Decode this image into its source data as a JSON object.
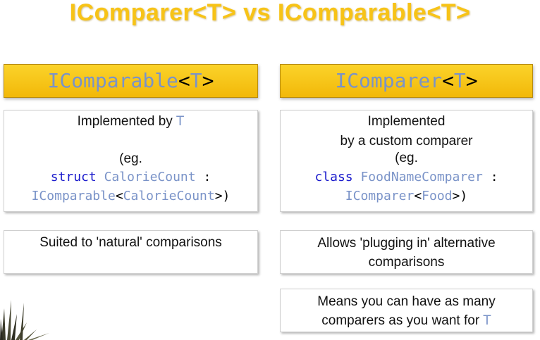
{
  "title": "IComparer<T> vs IComparable<T>",
  "left": {
    "header": {
      "name": "IComparable",
      "lt": "<",
      "t": "T",
      "gt": ">"
    },
    "box1": {
      "line1": "Implemented by ",
      "line1_t": "T",
      "eg": "(eg.",
      "kw": "struct",
      "type": "CalorieCount",
      "colon": ":",
      "iface": "IComparable",
      "lt": "<",
      "arg": "CalorieCount",
      "close": ">)"
    },
    "box2": {
      "text": "Suited to 'natural' comparisons"
    }
  },
  "right": {
    "header": {
      "name": "IComparer",
      "lt": "<",
      "t": "T",
      "gt": ">"
    },
    "box1": {
      "line1": "Implemented",
      "line2": "by a custom comparer",
      "eg": "(eg.",
      "kw": "class",
      "type": "FoodNameComparer",
      "colon": ":",
      "iface": "IComparer",
      "lt": "<",
      "arg": "Food",
      "close": ">)"
    },
    "box2": {
      "line1": "Allows 'plugging in' alternative",
      "line2": "comparisons"
    },
    "box3": {
      "line1": "Means you can have as many",
      "line2": "comparers as you want for ",
      "line2_t": "T"
    }
  },
  "colors": {
    "header_bg": "#f5c518",
    "title": "#f7c317",
    "keyword": "#1a1acc",
    "type_name": "#7a93c8"
  }
}
